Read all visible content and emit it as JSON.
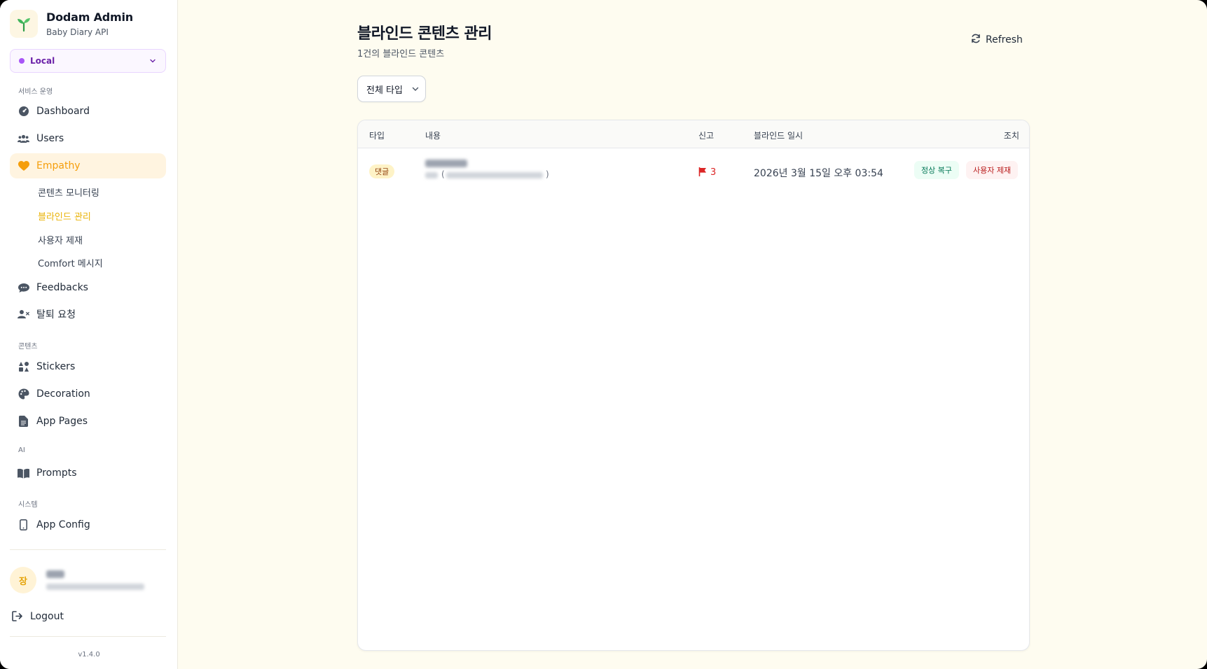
{
  "brand": {
    "title": "Dodam Admin",
    "subtitle": "Baby Diary API"
  },
  "environment": {
    "selected": "Local",
    "dot_color": "#a855f7"
  },
  "sidebar": {
    "sections": [
      {
        "label": "서비스 운영"
      },
      {
        "label": "콘텐츠"
      },
      {
        "label": "AI"
      },
      {
        "label": "시스템"
      }
    ],
    "items": {
      "dashboard": "Dashboard",
      "users": "Users",
      "empathy": "Empathy",
      "feedbacks": "Feedbacks",
      "withdrawal": "탈퇴 요청",
      "stickers": "Stickers",
      "decoration": "Decoration",
      "app_pages": "App Pages",
      "prompts": "Prompts",
      "app_config": "App Config"
    },
    "empathy_sub": {
      "monitoring": "콘텐츠 모니터링",
      "blind": "블라인드 관리",
      "sanctions": "사용자 제재",
      "comfort": "Comfort 메시지"
    },
    "active_color": "#f59e0b"
  },
  "user": {
    "avatar_initial": "장"
  },
  "logout_label": "Logout",
  "version": "v1.4.0",
  "page": {
    "title": "블라인드 콘텐츠 관리",
    "subtitle": "1건의 블라인드 콘텐츠",
    "refresh_label": "Refresh",
    "type_filter": "전체 타입"
  },
  "table": {
    "columns": {
      "type": "타입",
      "content": "내용",
      "reports": "신고",
      "blind_at": "블라인드 일시",
      "actions": "조치"
    },
    "rows": [
      {
        "type": "댓글",
        "paren_open": "(",
        "paren_close": ")",
        "reports": "3",
        "blind_at": "2026년 3월 15일 오후 03:54",
        "restore_label": "정상 복구",
        "sanction_label": "사용자 제재"
      }
    ]
  }
}
